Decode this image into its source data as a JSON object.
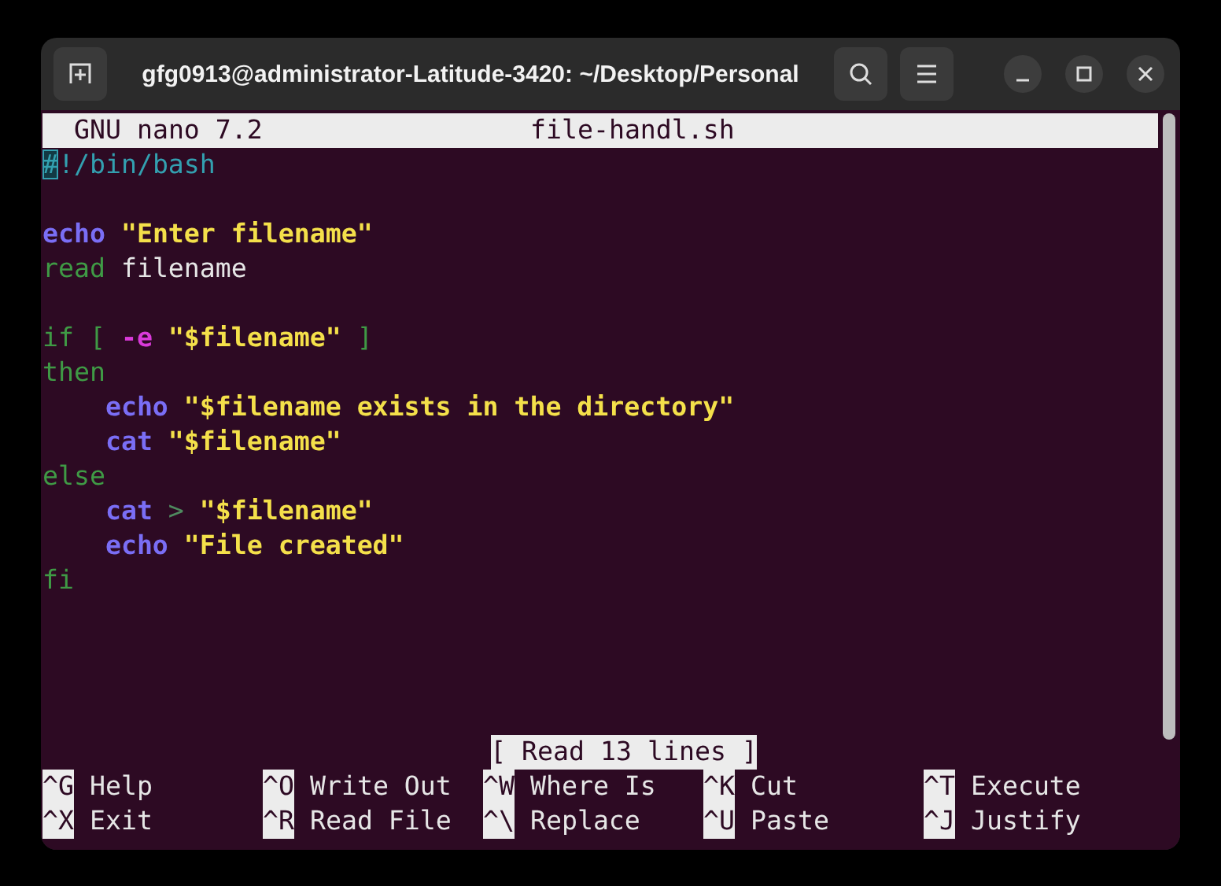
{
  "window": {
    "title": "gfg0913@administrator-Latitude-3420: ~/Desktop/Personal"
  },
  "header": {
    "app": "GNU nano 7.2",
    "file": "file-handl.sh"
  },
  "code_lines": [
    {
      "kind": "code",
      "tokens": [
        {
          "text": "#",
          "kind": "cursor"
        },
        {
          "text": "!/bin/bash",
          "kind": "shebang"
        }
      ]
    },
    {
      "kind": "blank"
    },
    {
      "kind": "code",
      "tokens": [
        {
          "text": "echo",
          "kind": "builtin"
        },
        {
          "text": " \"Enter filename\"",
          "kind": "string"
        }
      ]
    },
    {
      "kind": "code",
      "tokens": [
        {
          "text": "read",
          "kind": "keyword"
        },
        {
          "text": " filename",
          "kind": "plain"
        }
      ]
    },
    {
      "kind": "blank"
    },
    {
      "kind": "code",
      "tokens": [
        {
          "text": "if [",
          "kind": "keyword"
        },
        {
          "text": " -e",
          "kind": "option"
        },
        {
          "text": " \"$filename\"",
          "kind": "string"
        },
        {
          "text": " ]",
          "kind": "keyword"
        }
      ]
    },
    {
      "kind": "code",
      "tokens": [
        {
          "text": "then",
          "kind": "keyword"
        }
      ]
    },
    {
      "kind": "code",
      "tokens": [
        {
          "text": "    echo",
          "kind": "builtin"
        },
        {
          "text": " \"$filename exists in the directory\"",
          "kind": "string"
        }
      ]
    },
    {
      "kind": "code",
      "tokens": [
        {
          "text": "    cat",
          "kind": "builtin"
        },
        {
          "text": " \"$filename\"",
          "kind": "string"
        }
      ]
    },
    {
      "kind": "code",
      "tokens": [
        {
          "text": "else",
          "kind": "keyword"
        }
      ]
    },
    {
      "kind": "code",
      "tokens": [
        {
          "text": "    cat",
          "kind": "builtin"
        },
        {
          "text": " >",
          "kind": "operator"
        },
        {
          "text": " \"$filename\"",
          "kind": "string"
        }
      ]
    },
    {
      "kind": "code",
      "tokens": [
        {
          "text": "    echo",
          "kind": "builtin"
        },
        {
          "text": " \"File created\"",
          "kind": "string"
        }
      ]
    },
    {
      "kind": "code",
      "tokens": [
        {
          "text": "fi",
          "kind": "keyword"
        }
      ]
    }
  ],
  "status_message": "[ Read 13 lines ]",
  "shortcuts": [
    {
      "key": "^G",
      "label": "Help"
    },
    {
      "key": "^O",
      "label": "Write Out"
    },
    {
      "key": "^W",
      "label": "Where Is"
    },
    {
      "key": "^K",
      "label": "Cut"
    },
    {
      "key": "^T",
      "label": "Execute"
    },
    {
      "key": "^X",
      "label": "Exit"
    },
    {
      "key": "^R",
      "label": "Read File"
    },
    {
      "key": "^\\",
      "label": "Replace"
    },
    {
      "key": "^U",
      "label": "Paste"
    },
    {
      "key": "^J",
      "label": "Justify"
    }
  ]
}
